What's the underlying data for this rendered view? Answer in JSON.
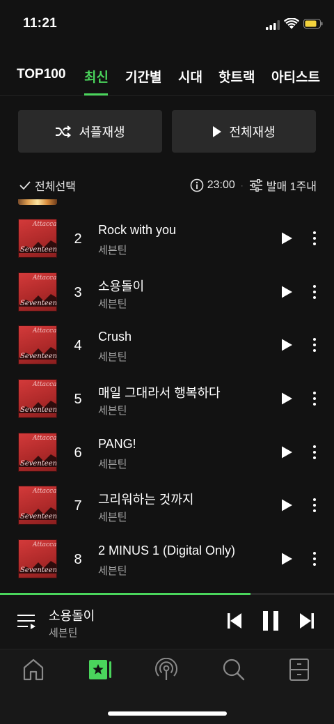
{
  "status": {
    "time": "11:21"
  },
  "tabs": [
    {
      "label": "TOP100",
      "active": false
    },
    {
      "label": "최신",
      "active": true
    },
    {
      "label": "기간별",
      "active": false
    },
    {
      "label": "시대",
      "active": false
    },
    {
      "label": "핫트랙",
      "active": false
    },
    {
      "label": "아티스트",
      "active": false
    }
  ],
  "actions": {
    "shuffle_label": "셔플재생",
    "play_all_label": "전체재생"
  },
  "controls": {
    "select_all": "전체선택",
    "time": "23:00",
    "filter": "발매 1주내"
  },
  "album": {
    "title": "Attacca",
    "artist": "Seventeen"
  },
  "tracks": [
    {
      "rank": "2",
      "title": "Rock with you",
      "artist": "세븐틴"
    },
    {
      "rank": "3",
      "title": "소용돌이",
      "artist": "세븐틴"
    },
    {
      "rank": "4",
      "title": "Crush",
      "artist": "세븐틴"
    },
    {
      "rank": "5",
      "title": "매일 그대라서 행복하다",
      "artist": "세븐틴"
    },
    {
      "rank": "6",
      "title": "PANG!",
      "artist": "세븐틴"
    },
    {
      "rank": "7",
      "title": "그리워하는 것까지",
      "artist": "세븐틴"
    },
    {
      "rank": "8",
      "title": "2 MINUS 1 (Digital Only)",
      "artist": "세븐틴"
    }
  ],
  "now_playing": {
    "title": "소용돌이",
    "artist": "세븐틴",
    "progress": 0.75
  },
  "nav": [
    "home-icon",
    "chart-icon",
    "podcast-icon",
    "search-icon",
    "library-icon"
  ],
  "colors": {
    "accent": "#4ad55c",
    "background": "#121212",
    "button": "#2a2a2a"
  }
}
